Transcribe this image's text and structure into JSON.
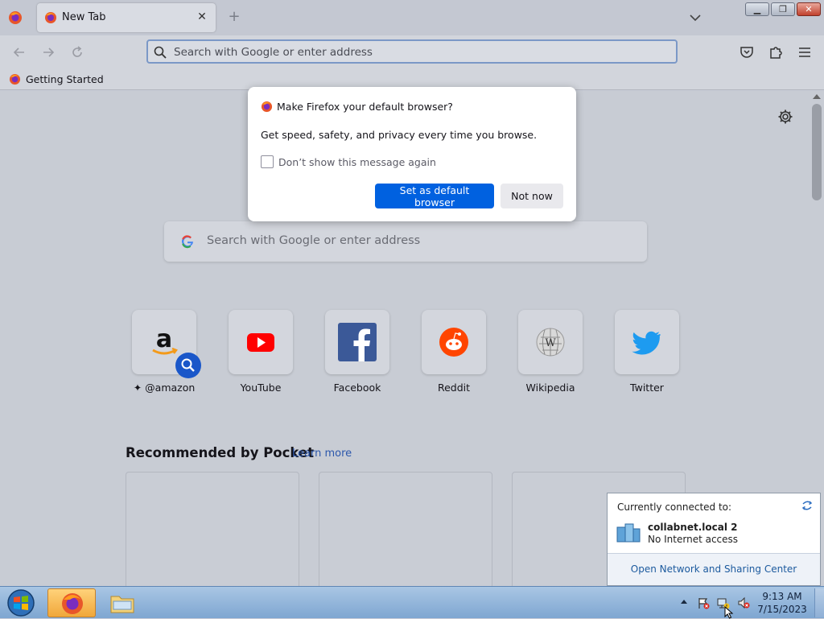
{
  "browser": {
    "tab_title": "New Tab",
    "tab_close": "✕",
    "new_tab": "+",
    "url_placeholder": "Search with Google or enter address",
    "bookmark": "Getting Started"
  },
  "newtab": {
    "search_placeholder": "Search with Google or enter address",
    "top_sites": [
      {
        "label": "@amazon",
        "icon": "amazon-icon"
      },
      {
        "label": "YouTube",
        "icon": "youtube-icon"
      },
      {
        "label": "Facebook",
        "icon": "facebook-icon"
      },
      {
        "label": "Reddit",
        "icon": "reddit-icon"
      },
      {
        "label": "Wikipedia",
        "icon": "wikipedia-icon"
      },
      {
        "label": "Twitter",
        "icon": "twitter-icon"
      }
    ],
    "pocket_heading": "Recommended by Pocket",
    "pocket_learn_more": "Learn more"
  },
  "dialog": {
    "title": "Make Firefox your default browser?",
    "description": "Get speed, safety, and privacy every time you browse.",
    "checkbox_label": "Don’t show this message again",
    "checkbox_checked": false,
    "primary_button": "Set as default browser",
    "secondary_button": "Not now"
  },
  "network_popup": {
    "title": "Currently connected to:",
    "network_name": "collabnet.local  2",
    "network_status": "No Internet access",
    "open_center_link": "Open Network and Sharing Center"
  },
  "taskbar": {
    "time": "9:13 AM",
    "date": "7/15/2023"
  },
  "colors": {
    "primary_button": "#0061e0",
    "link": "#2c57ac",
    "taskbar": "#8fb0d6"
  }
}
